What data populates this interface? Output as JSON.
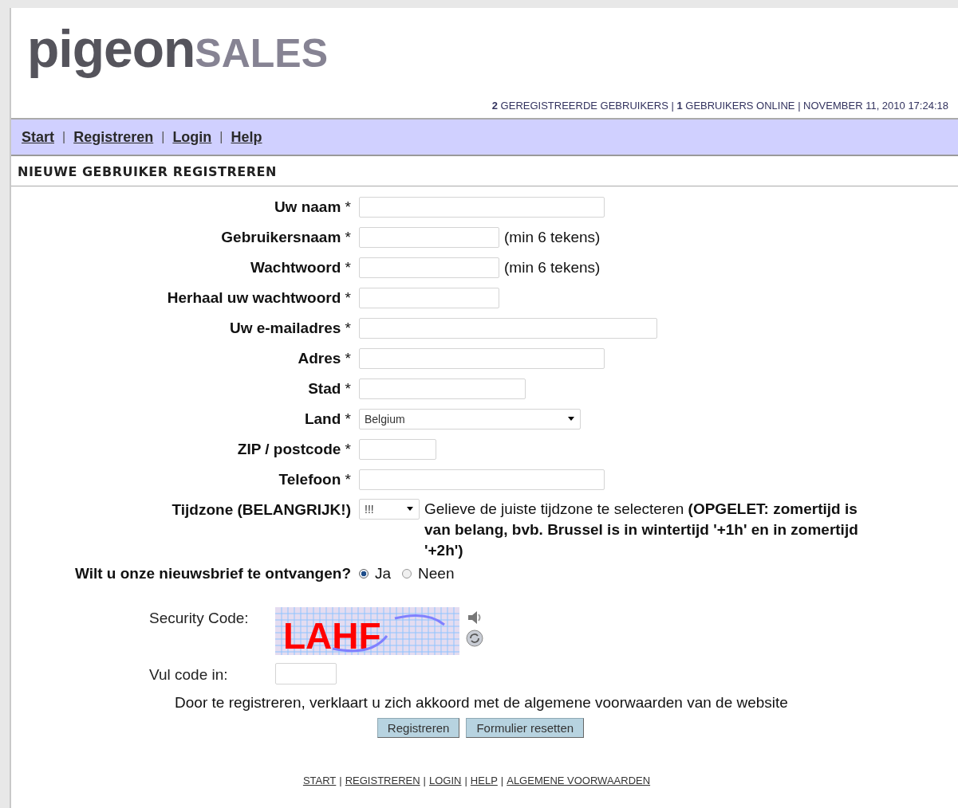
{
  "logo": {
    "main": "pigeon",
    "accent": "SALES"
  },
  "stats": "**2** GEREGISTREERDE GEBRUIKERS | **1** GEBRUIKERS ONLINE | NOVEMBER 11, 2010 17:24:18",
  "nav": {
    "separator": "|",
    "links": [
      "Start",
      "Registreren",
      "Login",
      "Help"
    ]
  },
  "section_title": "NIEUWE GEBRUIKER REGISTREREN",
  "fields": [
    {
      "kind": "text",
      "label": "**Uw naam** *"
    },
    {
      "kind": "text",
      "label": "**Gebruikersnaam** *",
      "hint": "(min 6 tekens)"
    },
    {
      "kind": "password",
      "label": "**Wachtwoord** *",
      "hint": "(min 6 tekens)"
    },
    {
      "kind": "password",
      "label": "**Herhaal uw wachtwoord** *"
    },
    {
      "kind": "text",
      "label": "**Uw e-mailadres** *"
    },
    {
      "kind": "text",
      "label": "**Adres** *"
    },
    {
      "kind": "text",
      "label": "**Stad** *"
    },
    {
      "kind": "select",
      "label": "**Land** *",
      "value": "Belgium"
    },
    {
      "kind": "text",
      "label": "**ZIP / postcode** *"
    },
    {
      "kind": "text",
      "label": "**Telefoon** *"
    },
    {
      "kind": "select",
      "label": "**Tijdzone (BELANGRIJK!)**",
      "value": "!!!",
      "note": "Gelieve de juiste tijdzone te selecteren **(OPGELET: zomertijd is van belang, bvb. Brussel is in wintertijd '+1h' en in zomertijd '+2h')**"
    }
  ],
  "newsletter": {
    "question": "Wilt u onze nieuwsbrief te ontvangen?",
    "options": [
      {
        "label": "Ja",
        "selected": true
      },
      {
        "label": "Neen",
        "selected": false
      }
    ]
  },
  "security": {
    "label": "Security Code:",
    "code": "LAHF",
    "input_label": "Vul code in:"
  },
  "agreement": "Door te registreren, verklaart u zich akkoord met de algemene voorwaarden van de website",
  "buttons": [
    "Registreren",
    "Formulier resetten"
  ],
  "footer": {
    "separator": "|",
    "links": [
      "START",
      "REGISTREREN",
      "LOGIN",
      "HELP",
      "ALGEMENE VOORWAARDEN"
    ]
  }
}
